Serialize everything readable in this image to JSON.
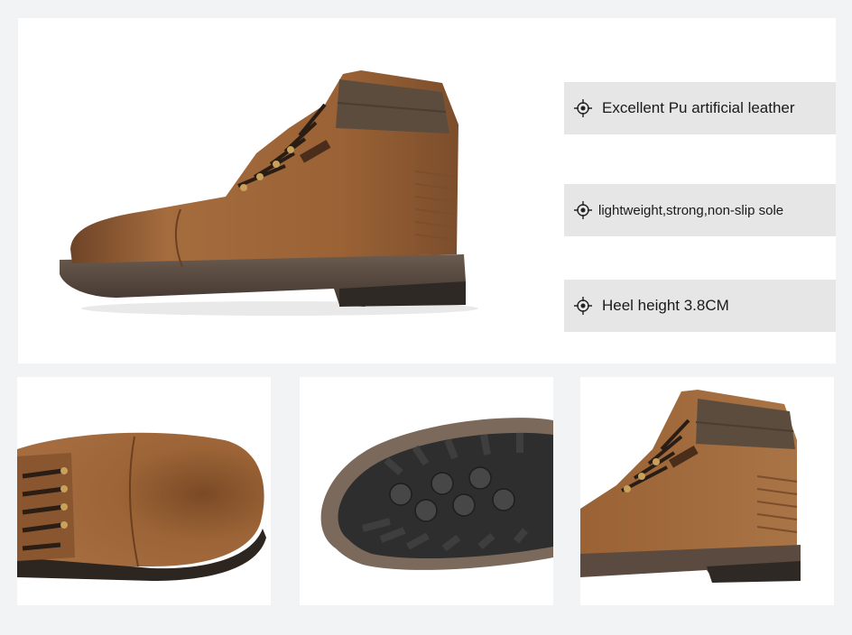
{
  "features": [
    {
      "label": "Excellent Pu artificial leather",
      "icon": "crosshair-icon"
    },
    {
      "label": "lightweight,strong,non-slip sole",
      "icon": "crosshair-icon"
    },
    {
      "label": "Heel height 3.8CM",
      "icon": "crosshair-icon"
    }
  ],
  "colors": {
    "leather": "#9a6235",
    "leather_light": "#b07a4a",
    "sole": "#5a4a3f",
    "collar": "#5b4c3e",
    "feature_bg": "#e6e6e6",
    "page_bg": "#f2f3f5"
  }
}
